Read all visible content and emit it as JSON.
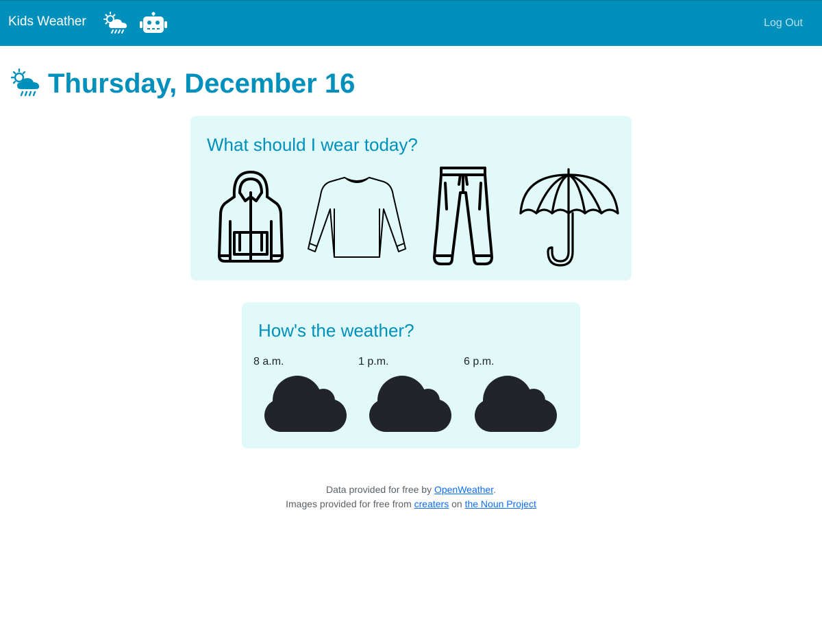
{
  "navbar": {
    "brand": "Kids Weather",
    "logout_label": "Log Out",
    "background_color": "#0090bb",
    "icons": [
      "weather-sun-cloud-rain-icon",
      "robot-icon"
    ]
  },
  "header": {
    "date": "Thursday, December 16",
    "icon": "sun-cloud-rain-icon",
    "color": "#0090bb"
  },
  "wear": {
    "title": "What should I wear today?",
    "items": [
      "jacket-icon",
      "long-sleeve-shirt-icon",
      "pants-icon",
      "umbrella-icon"
    ]
  },
  "weather": {
    "title": "How's the weather?",
    "periods": [
      {
        "time": "8 a.m.",
        "icon": "cloud-icon"
      },
      {
        "time": "1 p.m.",
        "icon": "cloud-icon"
      },
      {
        "time": "6 p.m.",
        "icon": "cloud-icon"
      }
    ]
  },
  "footer": {
    "line1_prefix": "Data provided for free by ",
    "line1_link": "OpenWeather",
    "line1_suffix": ".",
    "line2_prefix": "Images provided for free from ",
    "line2_link1": "creaters",
    "line2_mid": " on ",
    "line2_link2": "the Noun Project"
  },
  "colors": {
    "accent": "#0090bb",
    "card_background": "#e2f9f9",
    "link": "#0d6efd"
  }
}
